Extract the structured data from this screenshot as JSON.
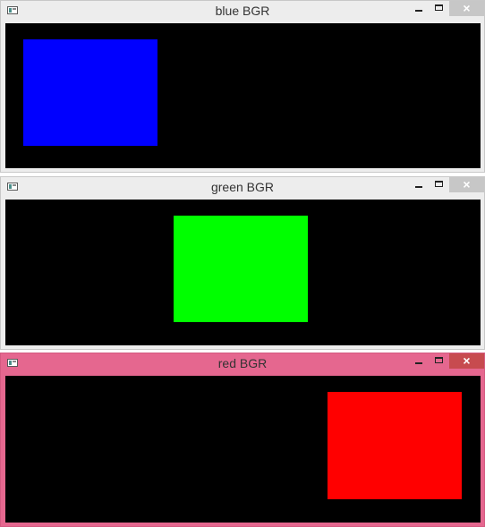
{
  "windows": [
    {
      "title": "blue BGR",
      "state": "inactive",
      "rect_color": "#0000ff",
      "controls": {
        "minimize_icon": "minimize-icon",
        "maximize_icon": "maximize-icon",
        "close_glyph": "×"
      }
    },
    {
      "title": "green BGR",
      "state": "inactive",
      "rect_color": "#00ff00",
      "controls": {
        "minimize_icon": "minimize-icon",
        "maximize_icon": "maximize-icon",
        "close_glyph": "×"
      }
    },
    {
      "title": "red BGR",
      "state": "active",
      "rect_color": "#ff0000",
      "controls": {
        "minimize_icon": "minimize-icon",
        "maximize_icon": "maximize-icon",
        "close_glyph": "×"
      }
    }
  ],
  "colors": {
    "canvas_background": "#000000",
    "active_frame": "#e5678f",
    "inactive_frame": "#ededed"
  }
}
